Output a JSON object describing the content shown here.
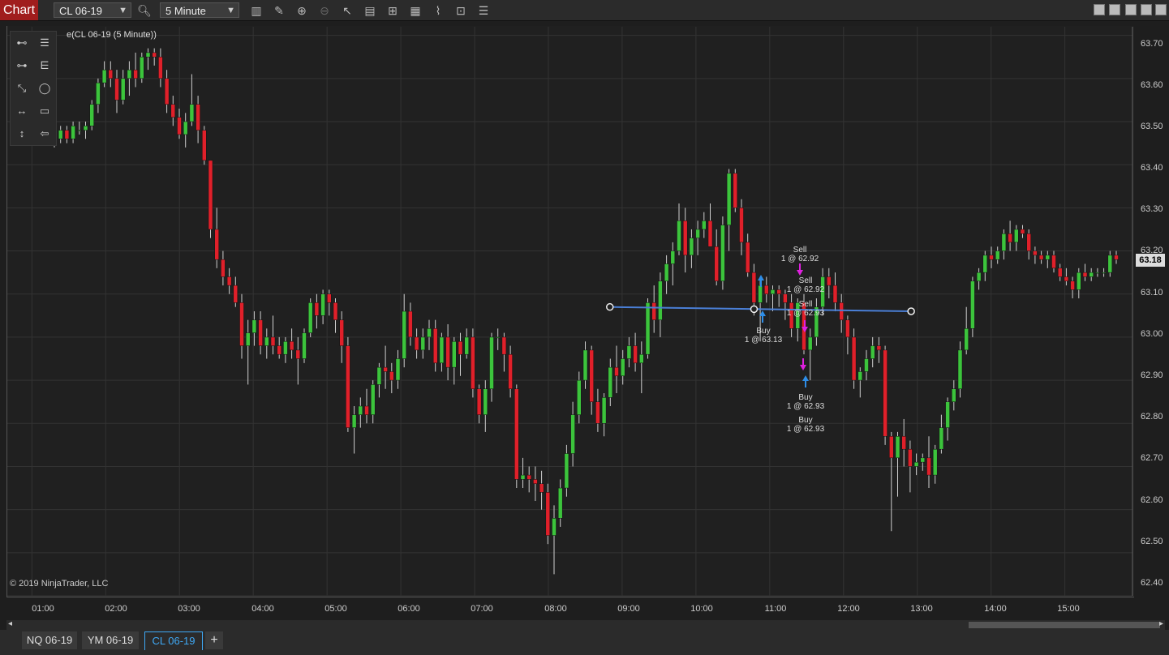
{
  "toolbar": {
    "title": "Chart",
    "instrument": "CL 06-19",
    "interval": "5 Minute"
  },
  "legend": "e(CL 06-19 (5 Minute))",
  "copyright": "© 2019 NinjaTrader, LLC",
  "y_axis": [
    "63.70",
    "63.60",
    "63.50",
    "63.40",
    "63.30",
    "63.20",
    "63.10",
    "63.00",
    "62.90",
    "62.80",
    "62.70",
    "62.60",
    "62.50",
    "62.40"
  ],
  "x_axis": [
    "01:00",
    "02:00",
    "03:00",
    "04:00",
    "05:00",
    "06:00",
    "07:00",
    "08:00",
    "09:00",
    "10:00",
    "11:00",
    "12:00",
    "13:00",
    "14:00",
    "15:00"
  ],
  "last_price": "63.18",
  "executions": [
    {
      "side": "Sell",
      "qty": "1 @ 62.92"
    },
    {
      "side": "Sell",
      "qty": "1 @ 62.92"
    },
    {
      "side": "Sell",
      "qty": "1 @ 62.93"
    },
    {
      "side": "Buy",
      "qty": "1 @ 63.13"
    },
    {
      "side": "Buy",
      "qty": "1 @ 62.93"
    },
    {
      "side": "Buy",
      "qty": "1 @ 62.93"
    }
  ],
  "tabs": [
    "NQ 06-19",
    "YM 06-19",
    "CL 06-19"
  ],
  "add_tab": "+",
  "colors": {
    "up": "#3cc43c",
    "down": "#e0202a",
    "trendline": "#4a7fd6",
    "buy_arrow": "#2e8ee8",
    "sell_arrow": "#e020e0"
  },
  "chart_data": {
    "type": "candlestick",
    "ylim": [
      62.4,
      63.72
    ],
    "x_range": [
      "00:40",
      "15:55"
    ],
    "trendline": {
      "start": [
        "08:50",
        63.07
      ],
      "end": [
        "12:55",
        63.06
      ]
    },
    "ohlc": [
      [
        63.45,
        63.5,
        63.44,
        63.46
      ],
      [
        63.46,
        63.49,
        63.45,
        63.48
      ],
      [
        63.48,
        63.49,
        63.45,
        63.46
      ],
      [
        63.46,
        63.5,
        63.45,
        63.49
      ],
      [
        63.48,
        63.5,
        63.47,
        63.48
      ],
      [
        63.48,
        63.5,
        63.46,
        63.49
      ],
      [
        63.49,
        63.55,
        63.48,
        63.54
      ],
      [
        63.54,
        63.6,
        63.52,
        63.59
      ],
      [
        63.59,
        63.64,
        63.58,
        63.62
      ],
      [
        63.62,
        63.64,
        63.58,
        63.6
      ],
      [
        63.6,
        63.62,
        63.52,
        63.55
      ],
      [
        63.55,
        63.62,
        63.54,
        63.6
      ],
      [
        63.6,
        63.64,
        63.56,
        63.62
      ],
      [
        63.62,
        63.66,
        63.58,
        63.6
      ],
      [
        63.6,
        63.66,
        63.59,
        63.65
      ],
      [
        63.65,
        63.67,
        63.62,
        63.66
      ],
      [
        63.66,
        63.67,
        63.63,
        63.65
      ],
      [
        63.65,
        63.67,
        63.58,
        63.6
      ],
      [
        63.6,
        63.62,
        63.52,
        63.54
      ],
      [
        63.54,
        63.56,
        63.49,
        63.51
      ],
      [
        63.51,
        63.53,
        63.46,
        63.47
      ],
      [
        63.47,
        63.52,
        63.44,
        63.5
      ],
      [
        63.5,
        63.61,
        63.49,
        63.54
      ],
      [
        63.54,
        63.56,
        63.45,
        63.48
      ],
      [
        63.48,
        63.49,
        63.4,
        63.41
      ],
      [
        63.41,
        63.41,
        63.23,
        63.25
      ],
      [
        63.25,
        63.3,
        63.16,
        63.18
      ],
      [
        63.18,
        63.2,
        63.12,
        63.14
      ],
      [
        63.14,
        63.16,
        63.1,
        63.12
      ],
      [
        63.12,
        63.14,
        63.07,
        63.08
      ],
      [
        63.08,
        63.1,
        62.95,
        62.98
      ],
      [
        62.98,
        63.04,
        62.89,
        63.01
      ],
      [
        63.01,
        63.06,
        62.98,
        63.04
      ],
      [
        63.04,
        63.06,
        62.96,
        62.98
      ],
      [
        62.98,
        63.02,
        62.95,
        63.0
      ],
      [
        63.0,
        63.05,
        62.96,
        62.98
      ],
      [
        62.98,
        63.0,
        62.95,
        62.96
      ],
      [
        62.96,
        63.0,
        62.94,
        62.99
      ],
      [
        62.99,
        63.02,
        62.95,
        62.97
      ],
      [
        62.97,
        63.0,
        62.89,
        62.95
      ],
      [
        62.95,
        63.02,
        62.94,
        63.01
      ],
      [
        63.01,
        63.09,
        63.0,
        63.08
      ],
      [
        63.08,
        63.1,
        63.02,
        63.05
      ],
      [
        63.05,
        63.11,
        63.03,
        63.1
      ],
      [
        63.1,
        63.11,
        63.05,
        63.08
      ],
      [
        63.08,
        63.09,
        63.01,
        63.04
      ],
      [
        63.04,
        63.06,
        62.94,
        62.98
      ],
      [
        62.98,
        63.0,
        62.78,
        62.79
      ],
      [
        62.79,
        62.84,
        62.73,
        62.82
      ],
      [
        62.82,
        62.86,
        62.79,
        62.84
      ],
      [
        62.84,
        62.88,
        62.8,
        62.82
      ],
      [
        62.82,
        62.9,
        62.8,
        62.89
      ],
      [
        62.89,
        62.94,
        62.86,
        62.93
      ],
      [
        62.93,
        62.98,
        62.88,
        62.92
      ],
      [
        62.92,
        62.94,
        62.87,
        62.9
      ],
      [
        62.9,
        62.97,
        62.88,
        62.95
      ],
      [
        62.95,
        63.1,
        62.93,
        63.06
      ],
      [
        63.06,
        63.08,
        62.98,
        63.0
      ],
      [
        63.0,
        63.02,
        62.95,
        62.97
      ],
      [
        62.97,
        63.02,
        62.95,
        63.0
      ],
      [
        63.0,
        63.04,
        62.97,
        63.02
      ],
      [
        63.02,
        63.04,
        62.92,
        62.94
      ],
      [
        62.94,
        63.01,
        62.92,
        63.0
      ],
      [
        63.0,
        63.03,
        62.9,
        62.93
      ],
      [
        62.93,
        63.0,
        62.89,
        62.99
      ],
      [
        62.99,
        63.01,
        62.91,
        62.96
      ],
      [
        62.96,
        63.02,
        62.95,
        63.0
      ],
      [
        63.0,
        63.02,
        62.86,
        62.88
      ],
      [
        62.88,
        62.89,
        62.8,
        62.82
      ],
      [
        62.82,
        62.9,
        62.78,
        62.88
      ],
      [
        62.88,
        63.01,
        62.85,
        63.0
      ],
      [
        63.0,
        63.02,
        62.97,
        63.0
      ],
      [
        63.0,
        63.01,
        62.92,
        62.96
      ],
      [
        62.96,
        62.98,
        62.86,
        62.88
      ],
      [
        62.88,
        62.89,
        62.65,
        62.67
      ],
      [
        62.67,
        62.72,
        62.65,
        62.68
      ],
      [
        62.68,
        62.7,
        62.64,
        62.67
      ],
      [
        62.67,
        62.7,
        62.62,
        62.66
      ],
      [
        62.66,
        62.69,
        62.6,
        62.64
      ],
      [
        62.64,
        62.66,
        62.52,
        62.54
      ],
      [
        62.54,
        62.61,
        62.45,
        62.58
      ],
      [
        62.58,
        62.67,
        62.56,
        62.65
      ],
      [
        62.65,
        62.75,
        62.63,
        62.73
      ],
      [
        62.73,
        62.85,
        62.7,
        62.82
      ],
      [
        62.82,
        62.92,
        62.8,
        62.9
      ],
      [
        62.9,
        62.99,
        62.88,
        62.97
      ],
      [
        62.97,
        62.98,
        62.82,
        62.85
      ],
      [
        62.85,
        62.88,
        62.78,
        62.8
      ],
      [
        62.8,
        62.87,
        62.77,
        62.86
      ],
      [
        62.86,
        62.95,
        62.84,
        62.93
      ],
      [
        62.93,
        62.98,
        62.87,
        62.91
      ],
      [
        62.91,
        62.97,
        62.89,
        62.95
      ],
      [
        62.95,
        63.0,
        62.93,
        62.98
      ],
      [
        62.98,
        63.01,
        62.92,
        62.94
      ],
      [
        62.94,
        62.99,
        62.87,
        62.96
      ],
      [
        62.96,
        63.09,
        62.95,
        63.08
      ],
      [
        63.08,
        63.12,
        63.01,
        63.04
      ],
      [
        63.04,
        63.15,
        63.0,
        63.13
      ],
      [
        63.13,
        63.19,
        63.1,
        63.17
      ],
      [
        63.17,
        63.22,
        63.12,
        63.2
      ],
      [
        63.2,
        63.31,
        63.19,
        63.27
      ],
      [
        63.27,
        63.3,
        63.15,
        63.19
      ],
      [
        63.19,
        63.25,
        63.16,
        63.23
      ],
      [
        63.23,
        63.27,
        63.19,
        63.25
      ],
      [
        63.25,
        63.29,
        63.23,
        63.27
      ],
      [
        63.27,
        63.31,
        63.24,
        63.21
      ],
      [
        63.21,
        63.25,
        63.12,
        63.13
      ],
      [
        63.13,
        63.28,
        63.11,
        63.26
      ],
      [
        63.26,
        63.39,
        63.2,
        63.38
      ],
      [
        63.38,
        63.39,
        63.29,
        63.3
      ],
      [
        63.3,
        63.32,
        63.19,
        63.22
      ],
      [
        63.22,
        63.24,
        63.14,
        63.15
      ],
      [
        63.15,
        63.17,
        63.05,
        63.08
      ],
      [
        63.08,
        63.14,
        62.99,
        63.12
      ],
      [
        63.12,
        63.14,
        63.08,
        63.1
      ],
      [
        63.1,
        63.12,
        63.06,
        63.11
      ],
      [
        63.11,
        63.12,
        63.07,
        63.1
      ],
      [
        63.1,
        63.11,
        63.04,
        63.08
      ],
      [
        63.08,
        63.1,
        63.0,
        63.02
      ],
      [
        63.02,
        63.09,
        62.99,
        63.08
      ],
      [
        63.08,
        63.1,
        62.96,
        62.97
      ],
      [
        62.97,
        63.02,
        62.9,
        63.0
      ],
      [
        63.0,
        63.09,
        62.98,
        63.07
      ],
      [
        63.07,
        63.16,
        63.05,
        63.14
      ],
      [
        63.14,
        63.16,
        63.09,
        63.12
      ],
      [
        63.12,
        63.15,
        63.06,
        63.08
      ],
      [
        63.08,
        63.1,
        63.01,
        63.04
      ],
      [
        63.04,
        63.05,
        62.96,
        63.0
      ],
      [
        63.0,
        63.02,
        62.88,
        62.9
      ],
      [
        62.9,
        62.93,
        62.86,
        62.92
      ],
      [
        62.92,
        62.97,
        62.9,
        62.95
      ],
      [
        62.95,
        63.0,
        62.93,
        62.98
      ],
      [
        62.98,
        63.0,
        62.94,
        62.97
      ],
      [
        62.97,
        62.98,
        62.75,
        62.77
      ],
      [
        62.77,
        62.78,
        62.55,
        62.72
      ],
      [
        62.72,
        62.78,
        62.63,
        62.77
      ],
      [
        62.77,
        62.81,
        62.7,
        62.74
      ],
      [
        62.74,
        62.76,
        62.64,
        62.7
      ],
      [
        62.7,
        62.73,
        62.68,
        62.71
      ],
      [
        62.71,
        62.73,
        62.69,
        62.72
      ],
      [
        62.72,
        62.77,
        62.65,
        62.68
      ],
      [
        62.68,
        62.75,
        62.66,
        62.74
      ],
      [
        62.74,
        62.82,
        62.73,
        62.79
      ],
      [
        62.79,
        62.86,
        62.76,
        62.85
      ],
      [
        62.85,
        62.9,
        62.83,
        62.88
      ],
      [
        62.88,
        62.99,
        62.86,
        62.97
      ],
      [
        62.97,
        63.07,
        62.96,
        63.02
      ],
      [
        63.02,
        63.14,
        63.0,
        63.13
      ],
      [
        63.13,
        63.16,
        63.11,
        63.15
      ],
      [
        63.15,
        63.2,
        63.13,
        63.19
      ],
      [
        63.19,
        63.21,
        63.16,
        63.18
      ],
      [
        63.18,
        63.21,
        63.17,
        63.2
      ],
      [
        63.2,
        63.25,
        63.18,
        63.24
      ],
      [
        63.24,
        63.27,
        63.2,
        63.22
      ],
      [
        63.22,
        63.26,
        63.2,
        63.25
      ],
      [
        63.25,
        63.26,
        63.23,
        63.24
      ],
      [
        63.24,
        63.25,
        63.18,
        63.2
      ],
      [
        63.2,
        63.21,
        63.17,
        63.19
      ],
      [
        63.19,
        63.2,
        63.17,
        63.18
      ],
      [
        63.18,
        63.2,
        63.16,
        63.19
      ],
      [
        63.19,
        63.2,
        63.15,
        63.16
      ],
      [
        63.16,
        63.17,
        63.13,
        63.14
      ],
      [
        63.14,
        63.16,
        63.12,
        63.13
      ],
      [
        63.13,
        63.14,
        63.09,
        63.11
      ],
      [
        63.11,
        63.16,
        63.09,
        63.15
      ],
      [
        63.15,
        63.17,
        63.13,
        63.14
      ],
      [
        63.14,
        63.16,
        63.13,
        63.15
      ],
      [
        63.15,
        63.16,
        63.14,
        63.15
      ],
      [
        63.15,
        63.16,
        63.14,
        63.15
      ],
      [
        63.15,
        63.2,
        63.14,
        63.19
      ],
      [
        63.19,
        63.2,
        63.17,
        63.18
      ]
    ]
  }
}
